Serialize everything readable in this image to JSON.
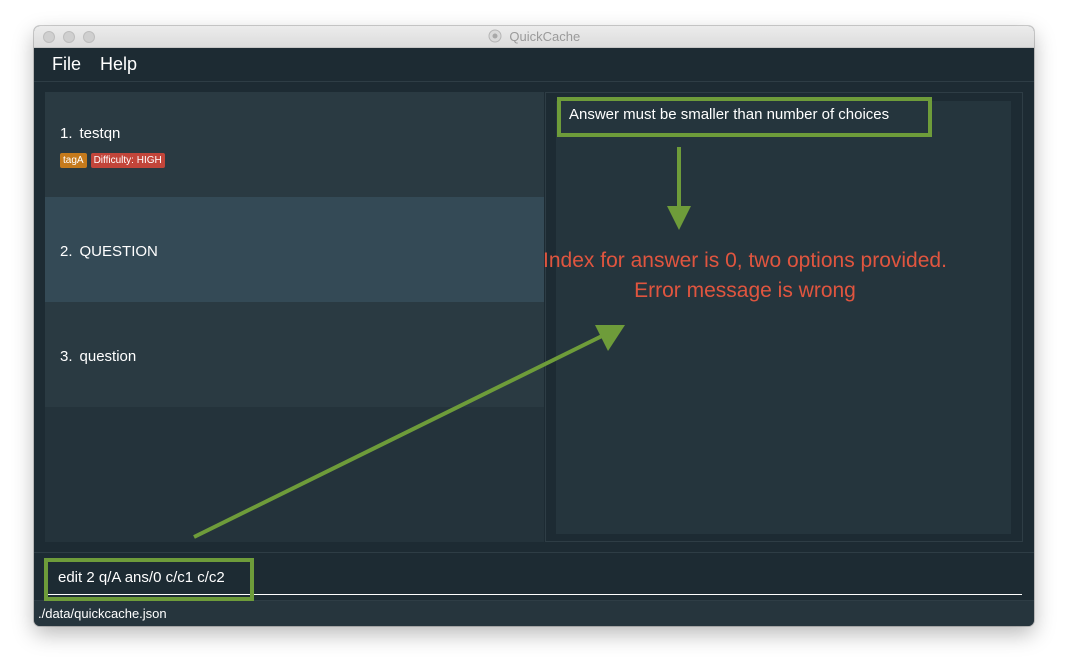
{
  "window": {
    "title": "QuickCache"
  },
  "menu": {
    "file": "File",
    "help": "Help"
  },
  "questions": [
    {
      "index": "1.",
      "text": "testqn",
      "tags": [
        "tagA",
        "Difficulty: HIGH"
      ]
    },
    {
      "index": "2.",
      "text": "QUESTION"
    },
    {
      "index": "3.",
      "text": "question"
    }
  ],
  "result": {
    "message": "Answer must be smaller than number of choices"
  },
  "command": {
    "value": "edit 2 q/A ans/0 c/c1 c/c2"
  },
  "status": {
    "path": "./data/quickcache.json"
  },
  "annotation": {
    "line1": "Index for answer is 0, two options provided.",
    "line2": "Error message is wrong",
    "highlight_color": "#6e9c3a",
    "text_color": "#e0553f"
  },
  "colors": {
    "window_bg": "#1d2b33",
    "card_bg": "#2a3a42",
    "card_selected_bg": "#344a56",
    "tag_orange": "#c57a1c",
    "tag_red": "#c2453a"
  }
}
